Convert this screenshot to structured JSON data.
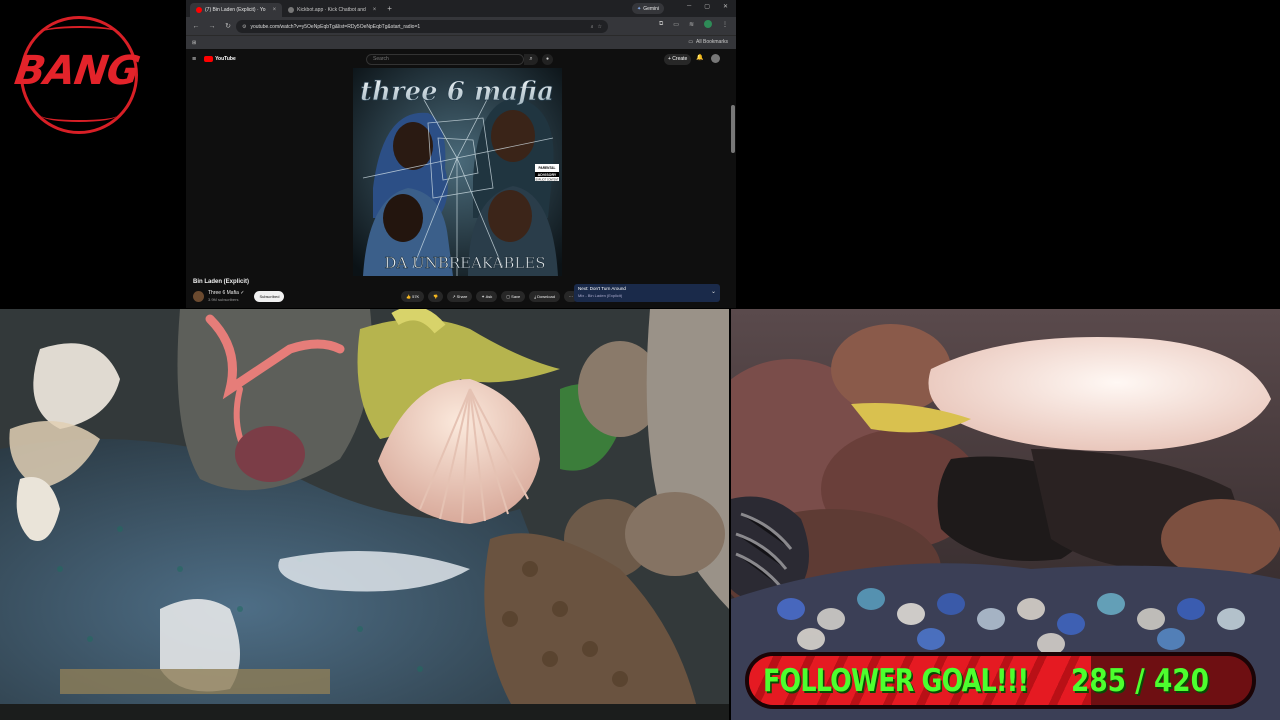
{
  "logo": {
    "text": "BANG"
  },
  "browser": {
    "tabs": [
      {
        "label": "(7) Bin Laden (Explicit) · Yo",
        "active": true,
        "favicon_color": "#ff0000"
      },
      {
        "label": "Kickbot.app · Kick Chatbot and",
        "active": false,
        "favicon_color": "#777777"
      }
    ],
    "gemini_label": "Gemini",
    "url": "youtube.com/watch?v=y5OeNpEqbTg&list=RDy5OeNpEqbTg&start_radio=1",
    "bookmarks_label": "All Bookmarks"
  },
  "youtube": {
    "logo_text": "YouTube",
    "search_placeholder": "Search",
    "create_label": "+ Create",
    "album": {
      "artist_title": "three 6 mafia",
      "album_title": "DA UNBREAKABLES",
      "advisory_line1": "PARENTAL",
      "advisory_line2": "ADVISORY",
      "advisory_line3": "EXPLICIT CONTENT"
    },
    "video_title": "Bin Laden (Explicit)",
    "channel_name": "Three 6 Mafia ✓",
    "channel_subs": "3.9M subscribers",
    "subscribe_label": "Subscribed",
    "actions": {
      "likes": "👍 57K",
      "dislike": "👎",
      "share": "↗ Share",
      "ask": "✦ Ask",
      "save": "▢ Save",
      "download": "⤓ Download",
      "more": "···"
    },
    "next": {
      "title": "Next: Don't Turn Around",
      "subtitle": "Mix - Bin Laden (Explicit)"
    }
  },
  "goal": {
    "label": "FOLLOWER GOAL!!!",
    "count": "285 / 420",
    "current": 285,
    "target": 420,
    "progress": 0.679
  },
  "colors": {
    "accent_red": "#e51a22",
    "goal_green": "#4dff2e",
    "logo_red": "#d81f26"
  }
}
